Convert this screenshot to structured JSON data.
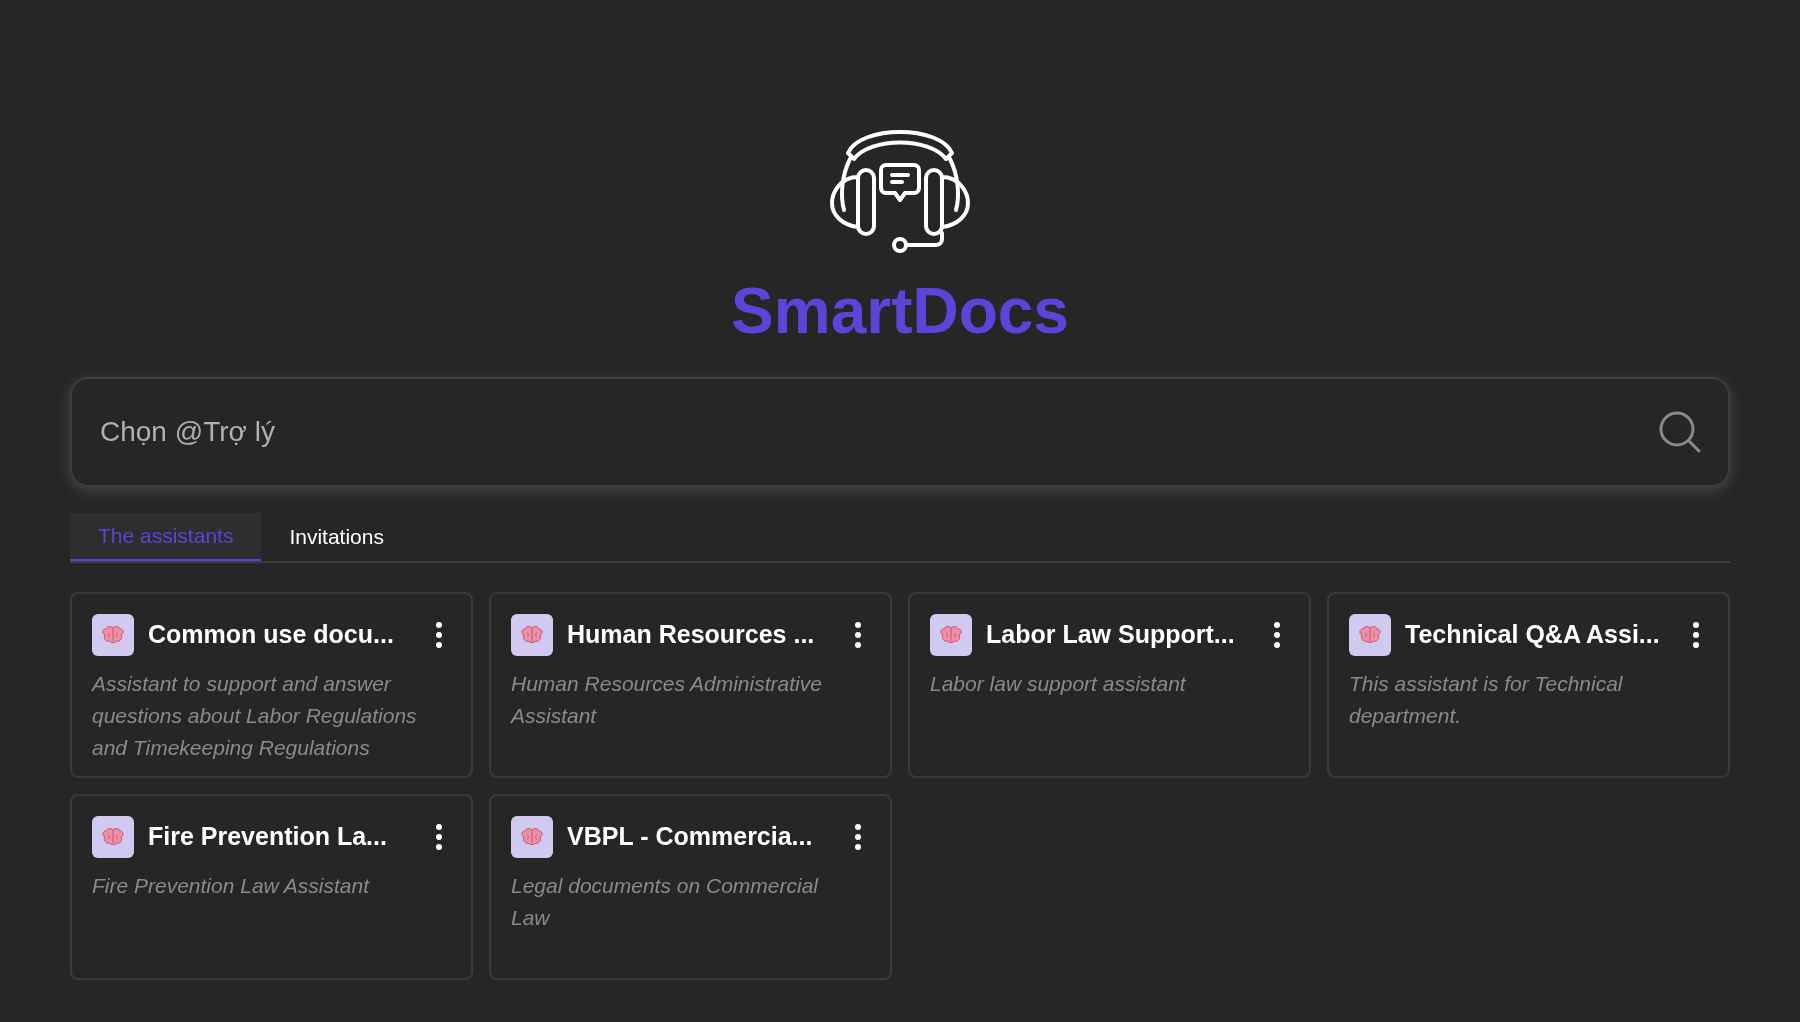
{
  "brand": {
    "name": "SmartDocs"
  },
  "search": {
    "placeholder": "Chọn @Trợ lý"
  },
  "tabs": [
    {
      "label": "The assistants",
      "selected": true
    },
    {
      "label": "Invitations",
      "selected": false
    }
  ],
  "assistants": [
    {
      "title": "Common use docu...",
      "description": "Assistant to support and answer questions about Labor Regulations and Timekeeping Regulations"
    },
    {
      "title": "Human Resources ...",
      "description": "Human Resources Administrative Assistant"
    },
    {
      "title": "Labor Law Support...",
      "description": "Labor law support assistant"
    },
    {
      "title": "Technical Q&A Assi...",
      "description": "This assistant is for Technical department."
    },
    {
      "title": "Fire Prevention La...",
      "description": "Fire Prevention Law Assistant"
    },
    {
      "title": "VBPL - Commercia...",
      "description": "Legal documents on Commercial Law"
    }
  ]
}
